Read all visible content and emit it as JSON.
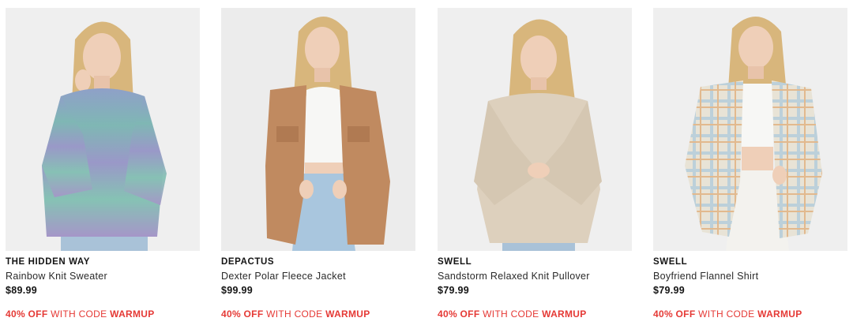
{
  "products": [
    {
      "brand": "THE HIDDEN WAY",
      "name": "Rainbow Knit Sweater",
      "price": "$89.99",
      "promo": {
        "discount": "40% OFF",
        "with_code": "WITH CODE",
        "code": "WARMUP"
      },
      "image": "model-rainbow-knit-sweater",
      "garment_colors": [
        "#8a94c4",
        "#7fb4b4",
        "#9aa0c8",
        "#86c0b4",
        "#a596c8"
      ]
    },
    {
      "brand": "DEPACTUS",
      "name": "Dexter Polar Fleece Jacket",
      "price": "$99.99",
      "promo": {
        "discount": "40% OFF",
        "with_code": "WITH CODE",
        "code": "WARMUP"
      },
      "image": "model-polar-fleece-jacket",
      "garment_colors": [
        "#c08a60"
      ]
    },
    {
      "brand": "SWELL",
      "name": "Sandstorm Relaxed Knit Pullover",
      "price": "$79.99",
      "promo": {
        "discount": "40% OFF",
        "with_code": "WITH CODE",
        "code": "WARMUP"
      },
      "image": "model-relaxed-knit-pullover",
      "garment_colors": [
        "#ddd0bd"
      ]
    },
    {
      "brand": "SWELL",
      "name": "Boyfriend Flannel Shirt",
      "price": "$79.99",
      "promo": {
        "discount": "40% OFF",
        "with_code": "WITH CODE",
        "code": "WARMUP"
      },
      "image": "model-flannel-shirt",
      "garment_colors": [
        "#e8e3d6",
        "#bcd0da",
        "#e2b98e"
      ]
    }
  ],
  "colors": {
    "promo_red": "#e53935",
    "hair": "#d8b67c",
    "skin": "#efcfb8",
    "photo_bg": "#efefef"
  }
}
